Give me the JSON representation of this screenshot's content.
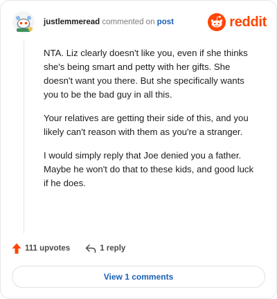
{
  "header": {
    "username": "justlemmeread",
    "verb": "commented on",
    "post_link": "post",
    "brand": "reddit"
  },
  "comment": {
    "paragraphs": [
      "NTA. Liz clearly doesn't like you, even if she thinks she's being smart and petty with her gifts. She doesn't want you there. But she specifically wants you to be the bad guy in all this.",
      "Your relatives are getting their side of this, and you likely can't reason with them as you're a stranger.",
      "I would simply reply that Joe denied you a father. Maybe he won't do that to these kids, and good luck if he does."
    ]
  },
  "actions": {
    "upvotes": "111 upvotes",
    "reply": "1 reply"
  },
  "footer": {
    "view_comments": "View 1 comments"
  },
  "colors": {
    "brand": "#ff4500",
    "link": "#1a5fb4",
    "upvote": "#ff4500"
  },
  "icons": [
    "avatar-snoo-icon",
    "reddit-logo-icon",
    "upvote-arrow-icon",
    "reply-arrow-icon"
  ]
}
